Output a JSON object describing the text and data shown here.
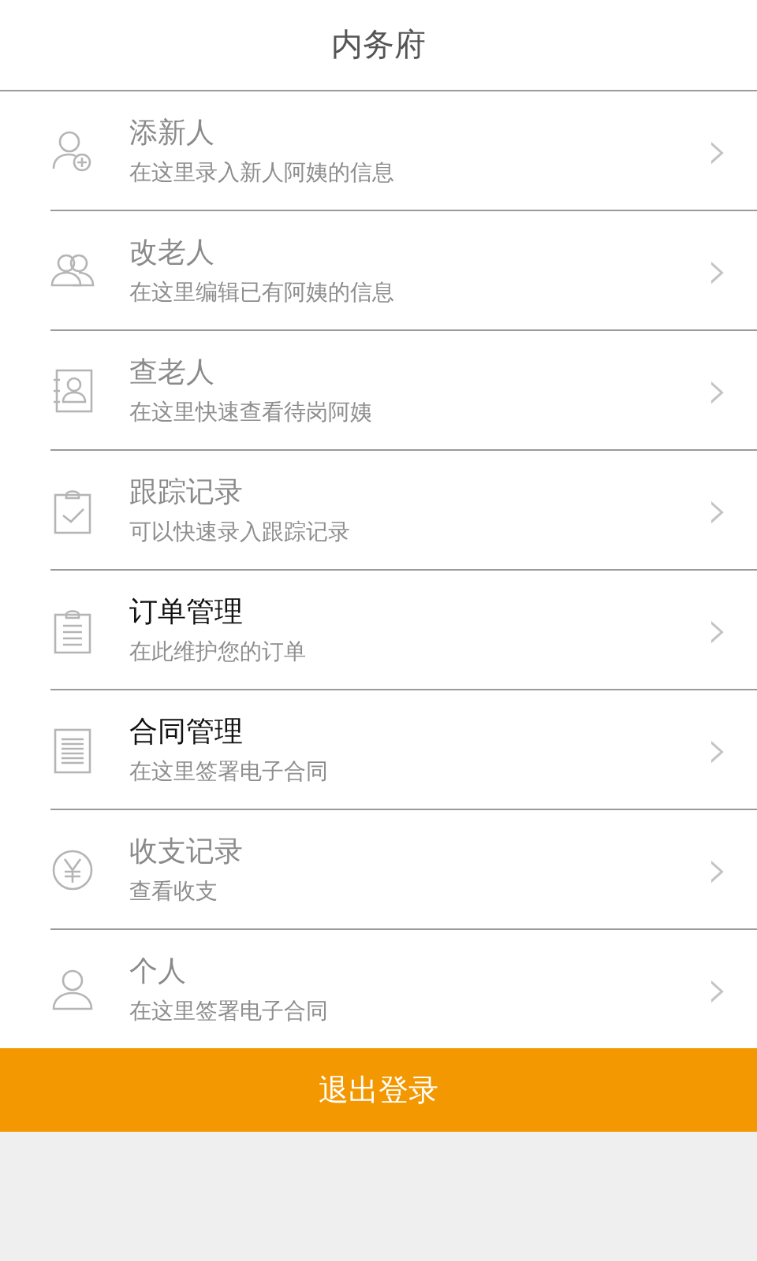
{
  "header": {
    "title": "内务府"
  },
  "menu": [
    {
      "title": "添新人",
      "subtitle": "在这里录入新人阿姨的信息",
      "disabled": true,
      "chevron": "›"
    },
    {
      "title": "改老人",
      "subtitle": "在这里编辑已有阿姨的信息",
      "disabled": true,
      "chevron": "›"
    },
    {
      "title": "查老人",
      "subtitle": "在这里快速查看待岗阿姨",
      "disabled": true,
      "chevron": "›"
    },
    {
      "title": "跟踪记录",
      "subtitle": "可以快速录入跟踪记录",
      "disabled": true,
      "chevron": "›"
    },
    {
      "title": "订单管理",
      "subtitle": "在此维护您的订单",
      "disabled": false,
      "chevron": "›"
    },
    {
      "title": "合同管理",
      "subtitle": "在这里签署电子合同",
      "disabled": false,
      "chevron": "›"
    },
    {
      "title": "收支记录",
      "subtitle": "查看收支",
      "disabled": true,
      "chevron": "›"
    },
    {
      "title": "个人",
      "subtitle": "在这里签署电子合同",
      "disabled": true,
      "chevron": "›"
    }
  ],
  "logout_button": {
    "label": "退出登录"
  }
}
